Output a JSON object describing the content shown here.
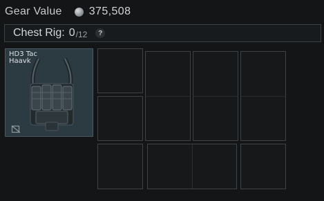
{
  "gear_value": {
    "label": "Gear Value",
    "amount": "375,508",
    "icon": "coin-icon"
  },
  "rig": {
    "label": "Chest Rig:",
    "count": "0",
    "capacity": "/12",
    "help": "?"
  },
  "item": {
    "name": "HD3 Tac Haavk",
    "icon": "chest-rig-icon",
    "badge_icon": "unlink-icon"
  },
  "slots": {
    "empty_count": 12
  }
}
